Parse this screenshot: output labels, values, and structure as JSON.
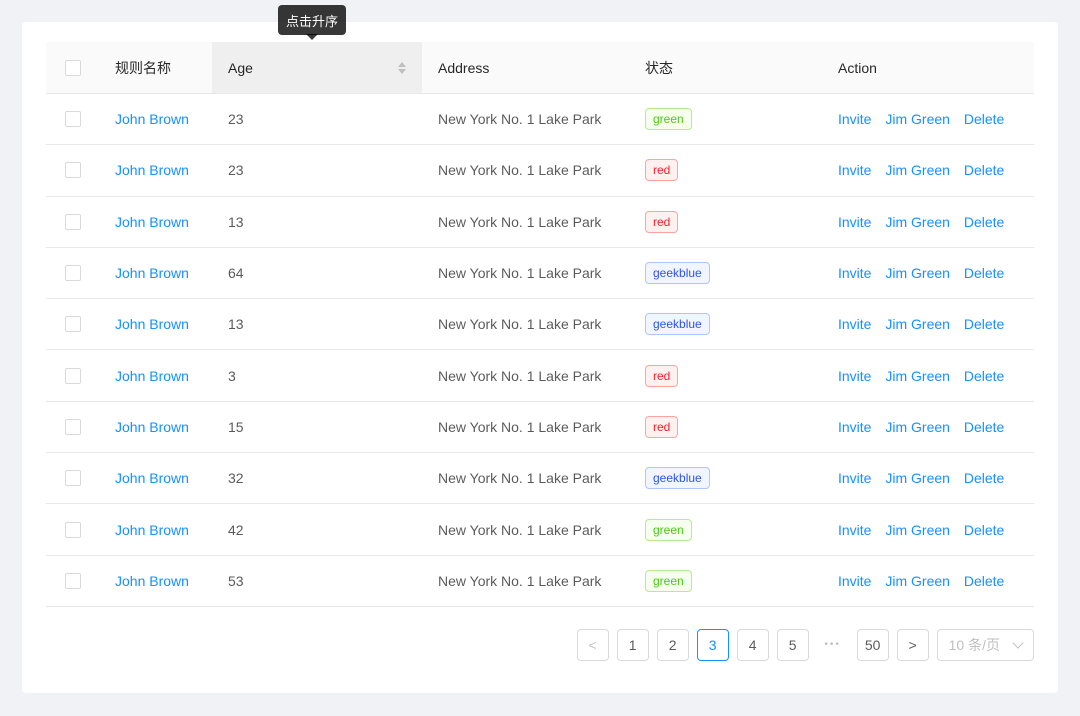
{
  "tooltip": {
    "text": "点击升序"
  },
  "table": {
    "header": {
      "name": "规则名称",
      "age": "Age",
      "address": "Address",
      "status": "状态",
      "action": "Action"
    },
    "rows": [
      {
        "name": "John Brown",
        "age": "23",
        "address": "New York No. 1 Lake Park",
        "tag": "green"
      },
      {
        "name": "John Brown",
        "age": "23",
        "address": "New York No. 1 Lake Park",
        "tag": "red"
      },
      {
        "name": "John Brown",
        "age": "13",
        "address": "New York No. 1 Lake Park",
        "tag": "red"
      },
      {
        "name": "John Brown",
        "age": "64",
        "address": "New York No. 1 Lake Park",
        "tag": "geekblue"
      },
      {
        "name": "John Brown",
        "age": "13",
        "address": "New York No. 1 Lake Park",
        "tag": "geekblue"
      },
      {
        "name": "John Brown",
        "age": "3",
        "address": "New York No. 1 Lake Park",
        "tag": "red"
      },
      {
        "name": "John Brown",
        "age": "15",
        "address": "New York No. 1 Lake Park",
        "tag": "red"
      },
      {
        "name": "John Brown",
        "age": "32",
        "address": "New York No. 1 Lake Park",
        "tag": "geekblue"
      },
      {
        "name": "John Brown",
        "age": "42",
        "address": "New York No. 1 Lake Park",
        "tag": "green"
      },
      {
        "name": "John Brown",
        "age": "53",
        "address": "New York No. 1 Lake Park",
        "tag": "green"
      }
    ],
    "actions": [
      "Invite",
      "Jim Green",
      "Delete"
    ]
  },
  "tag_colors": {
    "green": {
      "bg": "#f6ffed",
      "border": "#b7eb8f",
      "text": "#52c41a"
    },
    "red": {
      "bg": "#fff1f0",
      "border": "#ffa39e",
      "text": "#f5222d"
    },
    "geekblue": {
      "bg": "#f0f5ff",
      "border": "#adc6ff",
      "text": "#2f54eb"
    }
  },
  "pagination": {
    "prev": "<",
    "pages": [
      "1",
      "2",
      "3",
      "4",
      "5"
    ],
    "active_page": "3",
    "ellipsis": "•••",
    "last_page": "50",
    "next": ">",
    "page_size": "10 条/页"
  },
  "colors": {
    "link": "#1890ff",
    "header_bg": "#fafafa",
    "header_hover_bg": "#efefef",
    "row_border": "#e8e8e8",
    "page_bg": "#f0f2f5",
    "active_page_color": "#1890ff",
    "tooltip_bg": "rgba(0,0,0,0.78)"
  }
}
